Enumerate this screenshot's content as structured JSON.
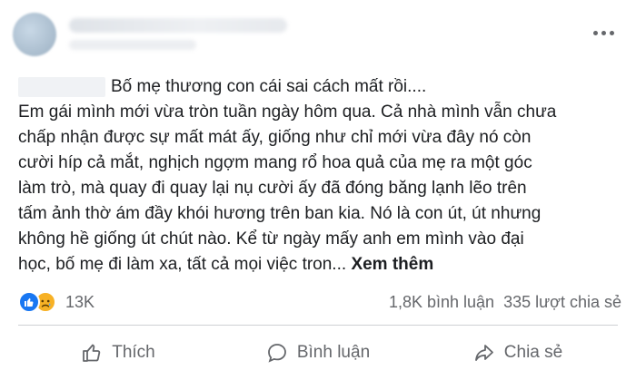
{
  "post": {
    "header": {
      "more_icon": "more-horizontal-icon"
    },
    "lines": [
      "Bố mẹ thương con cái sai cách mất rồi....",
      "Em gái mình mới vừa tròn tuần ngày hôm qua. Cả nhà mình vẫn chưa",
      "chấp nhận được sự mất mát ấy, giống như chỉ mới vừa đây nó còn",
      "cười híp cả mắt, nghịch ngợm mang rổ hoa quả của mẹ ra một góc",
      "làm trò, mà quay đi quay lại nụ cười ấy đã đóng băng lạnh lẽo trên",
      "tấm ảnh thờ ám đầy khói hương trên ban kia. Nó là con út, út nhưng",
      "không hề giống út chút nào. Kể từ ngày mấy anh em mình vào đại",
      "học, bố mẹ đi làm xa, tất cả mọi việc tron..."
    ],
    "see_more": "Xem thêm"
  },
  "reactions": {
    "icons": [
      "like-reaction-icon",
      "sad-reaction-icon"
    ],
    "count": "13K",
    "comments": "1,8K bình luận",
    "shares": "335 lượt chia sẻ"
  },
  "actions": {
    "like": "Thích",
    "comment": "Bình luận",
    "share": "Chia sẻ"
  },
  "colors": {
    "like_blue": "#1877f2",
    "sad_yellow": "#f7b125",
    "secondary_text": "#65676b",
    "primary_text": "#1c1e21"
  }
}
